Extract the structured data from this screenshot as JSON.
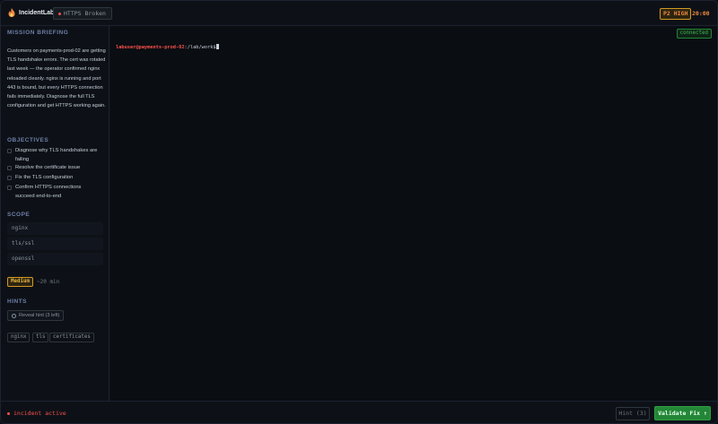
{
  "app": {
    "name": "IncidentLab"
  },
  "scenario": {
    "label": "HTTPS Broken"
  },
  "severity": {
    "label": "P2 HIGH",
    "color": "#f0883e"
  },
  "timer": {
    "value": "20:00"
  },
  "sidebar": {
    "briefing_title": "MISSION BRIEFING",
    "briefing_text": "Customers on payments-prod-02 are getting TLS handshake errors. The cert was rotated last week — the operator confirmed nginx reloaded cleanly. nginx is running and port 443 is bound, but every HTTPS connection fails immediately. Diagnose the full TLS configuration and get HTTPS working again.",
    "objectives_title": "OBJECTIVES",
    "objectives": [
      {
        "label": "Diagnose why TLS handshakes are failing",
        "checked": false
      },
      {
        "label": "Resolve the certificate issue",
        "checked": false
      },
      {
        "label": "Fix the TLS configuration",
        "checked": false
      },
      {
        "label": "Confirm HTTPS connections succeed end-to-end",
        "checked": false
      }
    ],
    "scope_title": "SCOPE",
    "scope": [
      "nginx",
      "tls/ssl",
      "openssl"
    ],
    "difficulty": "Medium",
    "eta": "~20 min",
    "hints_title": "HINTS",
    "hint_button": "Reveal hint (3 left)",
    "tags": [
      "nginx",
      "tls",
      "certificates"
    ]
  },
  "terminal": {
    "status": "connected",
    "prompt_user": "labuser@payments-prod-02",
    "prompt_path": ":/lab/work$"
  },
  "footer": {
    "status": "incident active",
    "hint_label": "Hint (3)",
    "validate_label": "Validate Fix ↑"
  },
  "colors": {
    "accent_green": "#238636",
    "alert_red": "#f85149",
    "warning_amber": "#d29922"
  }
}
